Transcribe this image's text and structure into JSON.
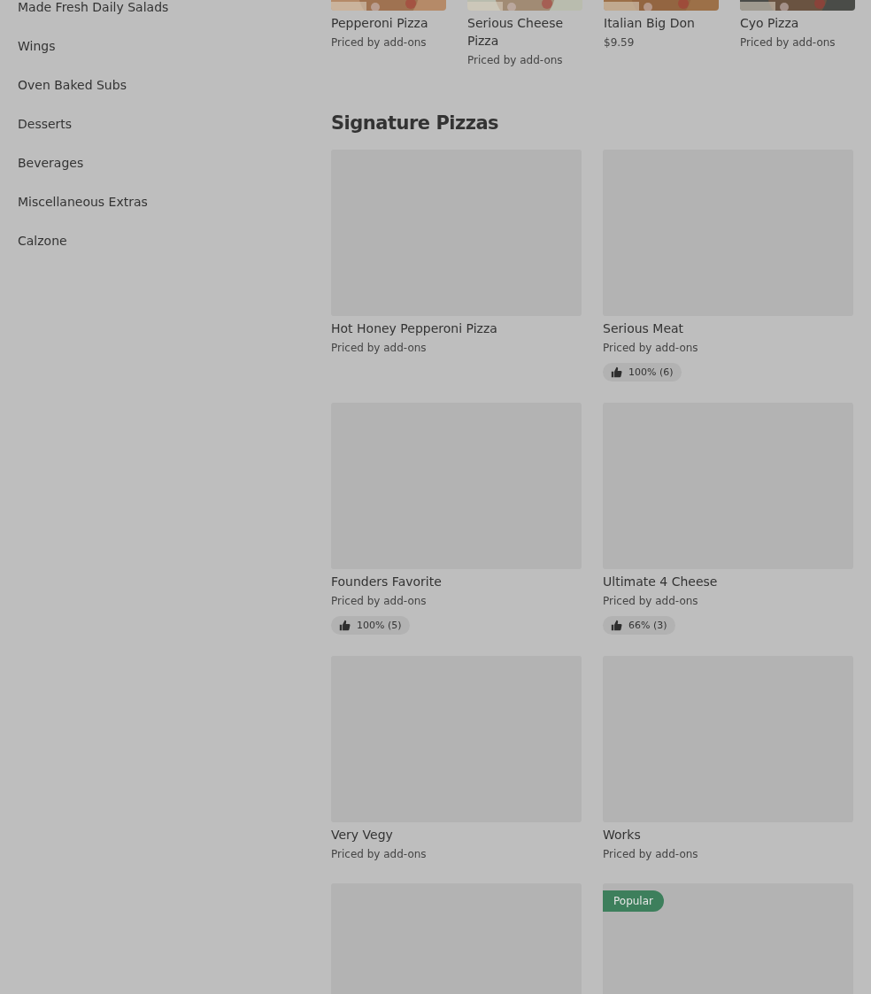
{
  "sidebar": {
    "items": [
      {
        "label": "Made Fresh Daily Salads"
      },
      {
        "label": "Wings"
      },
      {
        "label": "Oven Baked Subs"
      },
      {
        "label": "Desserts"
      },
      {
        "label": "Beverages"
      },
      {
        "label": "Miscellaneous Extras"
      },
      {
        "label": "Calzone"
      }
    ]
  },
  "top_row": {
    "items": [
      {
        "name": "Pepperoni Pizza",
        "price": "Priced by add-ons"
      },
      {
        "name": "Serious Cheese Pizza",
        "price": "Priced by add-ons"
      },
      {
        "name": "Italian Big Don",
        "price": "$9.59"
      },
      {
        "name": "Cyo Pizza",
        "price": "Priced by add-ons"
      }
    ]
  },
  "section": {
    "title": "Signature Pizzas",
    "items": [
      {
        "kind": "item",
        "name": "Hot Honey Pepperoni Pizza",
        "price": "Priced by add-ons"
      },
      {
        "kind": "item",
        "name": "Serious Meat",
        "price": "Priced by add-ons",
        "rating": "100% (6)"
      },
      {
        "kind": "item",
        "name": "Founders Favorite",
        "price": "Priced by add-ons",
        "rating": "100% (5)"
      },
      {
        "kind": "item",
        "name": "Ultimate 4 Cheese",
        "price": "Priced by add-ons",
        "rating": "66% (3)"
      },
      {
        "kind": "item",
        "name": "Very Vegy",
        "price": "Priced by add-ons"
      },
      {
        "kind": "item",
        "name": "Works",
        "price": "Priced by add-ons"
      },
      {
        "kind": "card"
      },
      {
        "kind": "card",
        "badge": "Popular"
      }
    ]
  }
}
